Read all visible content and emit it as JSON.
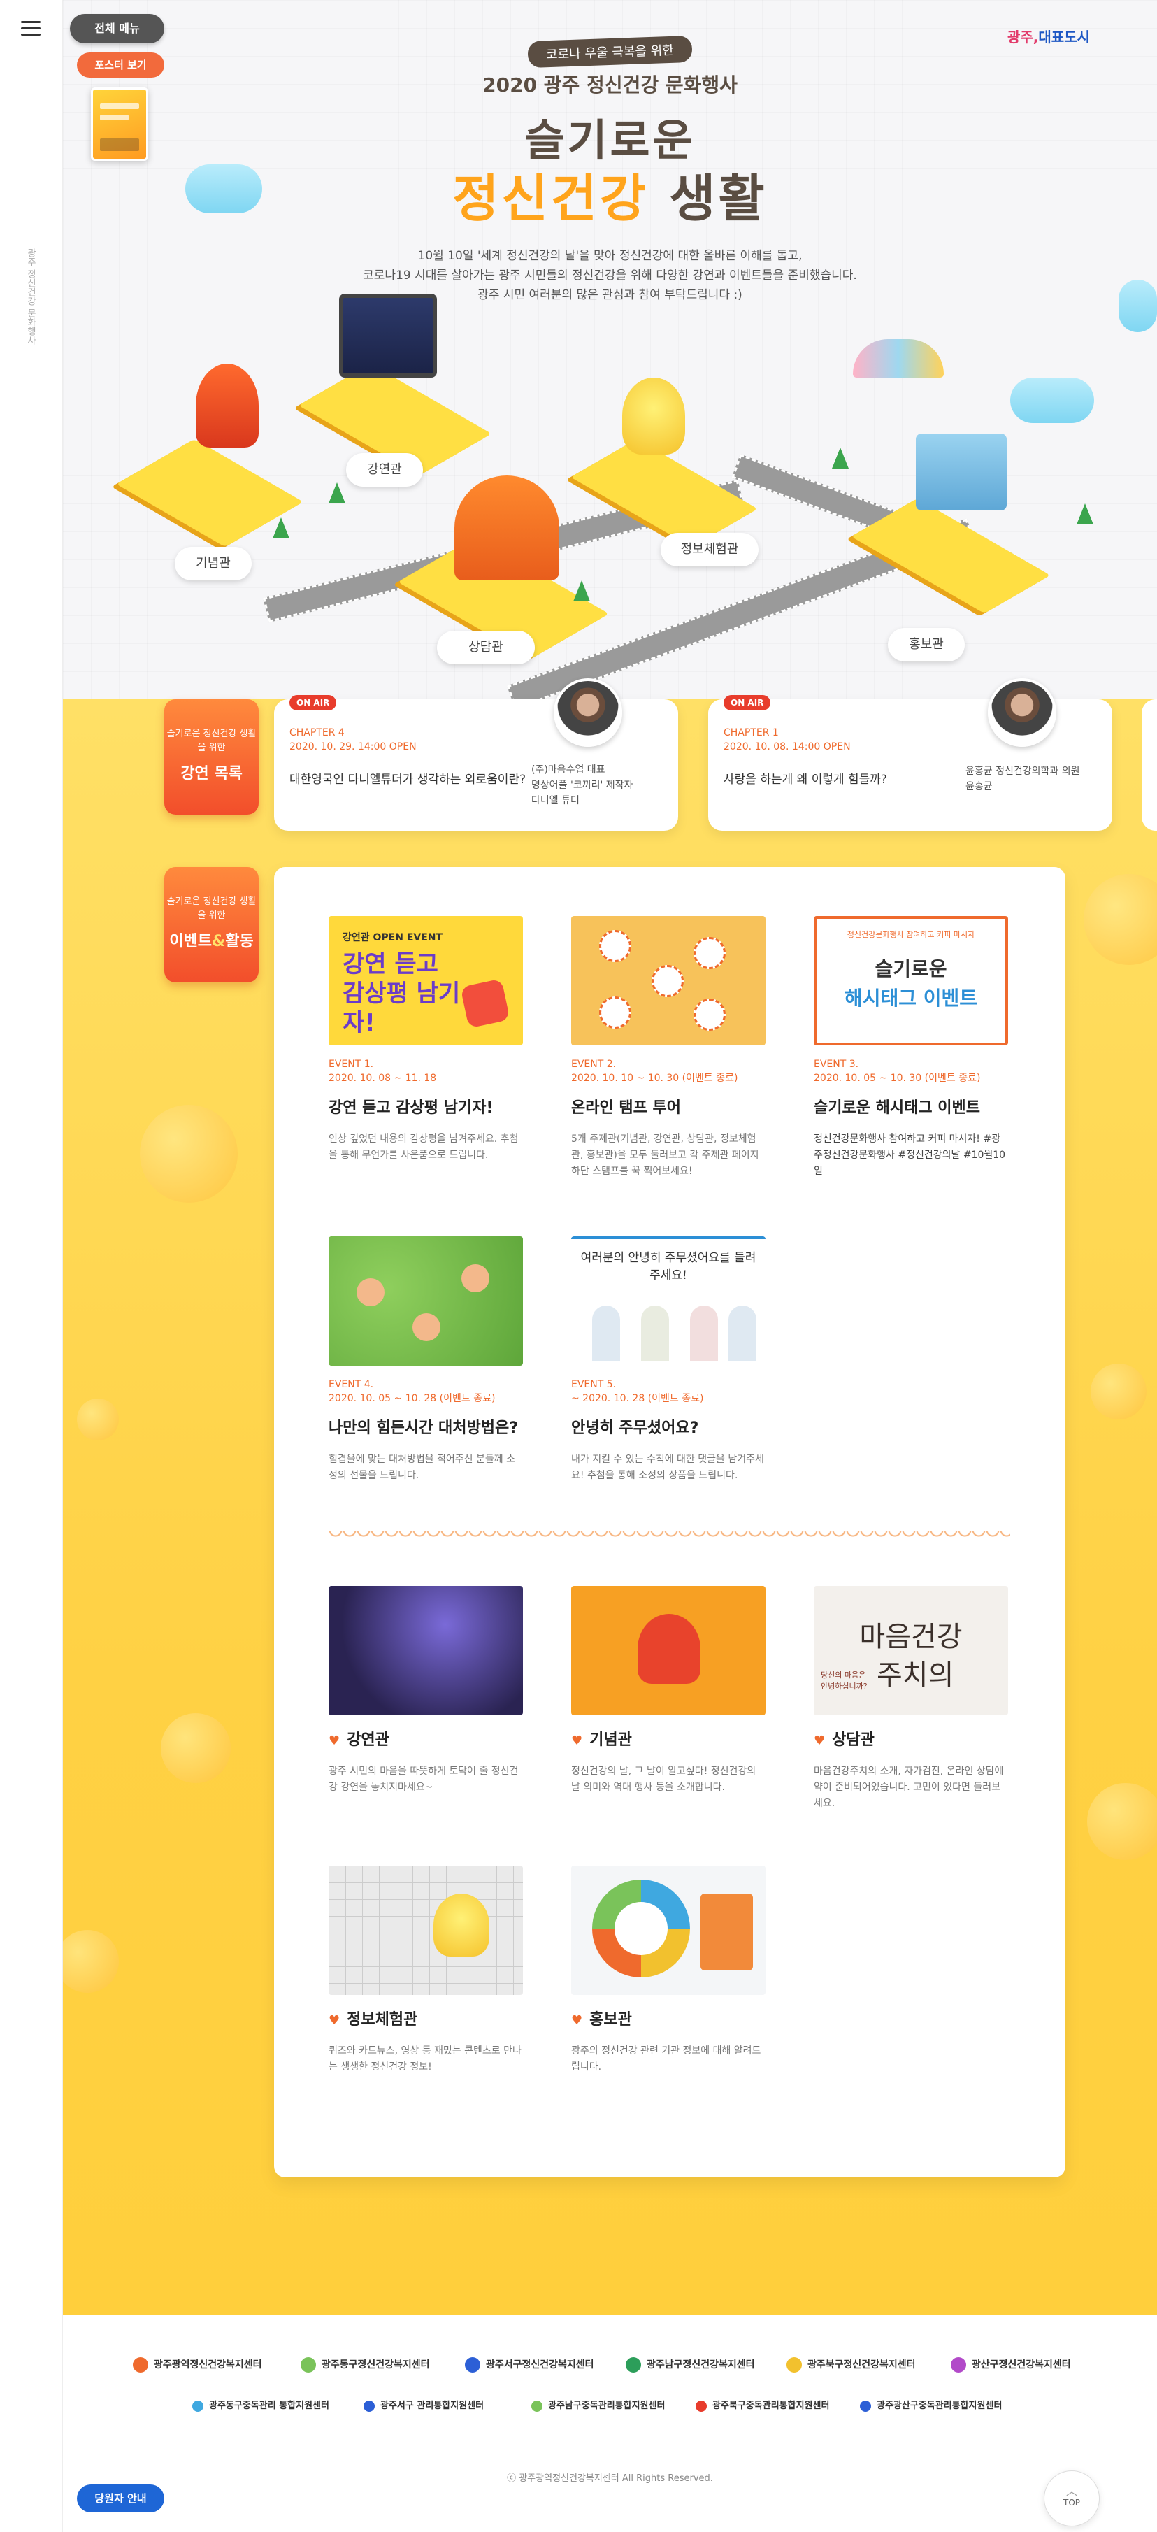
{
  "rail": {
    "menu_icon": "hamburger-icon",
    "vertical_text": "광주 정신건강 문화행사"
  },
  "buttons": {
    "all_menu": "전체 메뉴",
    "poster": "포스터 보기",
    "duty": "당원자 안내",
    "top": "TOP"
  },
  "hero": {
    "logo_text_a": "광주,",
    "logo_text_b": "대표도시",
    "pre_title": "코로나 우울 극복을 위한",
    "event_name": "2020 광주 정신건강 문화행사",
    "title_line1": "슬기로운",
    "title_line2_accent": "정신건강",
    "title_line2_rest": "생활",
    "intro_line1": "10월 10일 '세계 정신건강의 날'을 맞아 정신건강에 대한 올바른 이해를 돕고,",
    "intro_line2": "코로나19 시대를 살아가는 광주 시민들의 정신건강을 위해 다양한 강연과 이벤트들을 준비했습니다.",
    "intro_line3": "광주 시민 여러분의 많은 관심과 참여 부탁드립니다 :)",
    "halls": {
      "lecture": "강연관",
      "memorial": "기념관",
      "info": "정보체험관",
      "counsel": "상담관",
      "promo": "홍보관"
    }
  },
  "lecture_section": {
    "tag_small": "슬기로운 정신건강 생활을 위한",
    "tag_big": "강연 목록",
    "cards": [
      {
        "badge": "ON AIR",
        "chapter": "CHAPTER 4",
        "date": "2020. 10. 29. 14:00 OPEN",
        "title": "대한영국인 다니엘튜더가 생각하는 외로움이란?",
        "speaker_line1": "(주)마음수업 대표",
        "speaker_line2": "명상어플 '코끼리' 제작자",
        "speaker_line3": "다니엘 튜더"
      },
      {
        "badge": "ON AIR",
        "chapter": "CHAPTER 1",
        "date": "2020. 10. 08. 14:00 OPEN",
        "title": "사랑을 하는게 왜 이렇게 힘들까?",
        "speaker_line1": "윤홍균 정신건강의학과 의원",
        "speaker_line2": "윤홍균"
      }
    ]
  },
  "event_section": {
    "tag_small": "슬기로운 정신건강 생활을 위한",
    "tag_big_a": "이벤트",
    "tag_big_amp": "&",
    "tag_big_b": "활동",
    "events": [
      {
        "thumb_top": "강연관 OPEN EVENT",
        "thumb_big": "강연 듣고 감상평 남기자!",
        "num": "EVENT 1.",
        "date": "2020. 10. 08 ~ 11. 18",
        "title": "강연 듣고 감상평 남기자!",
        "desc": "인상 깊었던 내용의 감상평을 남겨주세요. 추첨을 통해 무언가를 사은품으로 드립니다."
      },
      {
        "num": "EVENT 2.",
        "date": "2020. 10. 10 ~ 10. 30 (이벤트 종료)",
        "title": "온라인 탬프 투어",
        "desc": "5개 주제관(기념관, 강연관, 상담관, 정보체험관, 홍보관)을 모두 둘러보고 각 주제관 페이지 하단 스탬프를 꾹 찍어보세요!"
      },
      {
        "thumb_top": "정신건강문화행사 참여하고 커피 마시자",
        "thumb_big_a": "슬기로운",
        "thumb_big_b": "해시태그 이벤트",
        "num": "EVENT 3.",
        "date": "2020. 10. 05 ~ 10. 30 (이벤트 종료)",
        "title": "슬기로운 해시태그 이벤트",
        "desc": "정신건강문화행사 참여하고 커피 마시자! #광주정신건강문화행사 #정신건강의날 #10월10일"
      },
      {
        "num": "EVENT 4.",
        "date": "2020. 10. 05 ~ 10. 28 (이벤트 종료)",
        "title": "나만의 힘든시간 대처방법은?",
        "desc": "힘겹을에 맞는 대처방법을 적어주신 분들께 소정의 선물을 드립니다."
      },
      {
        "thumb_top": "여러분의 안녕히 주무셨어요를 들려주세요!",
        "num": "EVENT 5.",
        "date": "~ 2020. 10. 28 (이벤트 종료)",
        "title": "안녕히 주무셨어요?",
        "desc": "내가 지킬 수 있는 수칙에 대한 댓글을 남겨주세요! 추첨을 통해 소정의 상품을 드립니다."
      }
    ],
    "halls": [
      {
        "title": "강연관",
        "desc": "광주 시민의 마음을 따뜻하게 토닥여 줄 정신건강 강연을 놓치지마세요~"
      },
      {
        "title": "기념관",
        "desc": "정신건강의 날, 그 날이 알고싶다! 정신건강의 날 의미와 역대 행사 등을 소개합니다."
      },
      {
        "title": "상담관",
        "thumb_text_a": "마음건강",
        "thumb_text_b": "주치의",
        "thumb_small": "당신의 마음은 안녕하십니까?",
        "desc": "마음건강주치의 소개, 자가검진, 온라인 상담예약이 준비되어있습니다. 고민이 있다면 들러보세요."
      },
      {
        "title": "정보체험관",
        "desc": "퀴즈와 카드뉴스, 영상 등 재밌는 콘텐츠로 만나는 생생한 정신건강 정보!"
      },
      {
        "title": "홍보관",
        "desc": "광주의 정신건강 관련 기관 정보에 대해 알려드립니다."
      }
    ]
  },
  "footer": {
    "orgs_row1": [
      "광주광역정신건강복지센터",
      "광주동구정신건강복지센터",
      "광주서구정신건강복지센터",
      "광주남구정신건강복지센터",
      "광주북구정신건강복지센터",
      "광산구정신건강복지센터"
    ],
    "orgs_row2": [
      "광주동구중독관리 통합지원센터",
      "광주서구 관리통합지원센터",
      "광주남구중독관리통합지원센터",
      "광주북구중독관리통합지원센터",
      "광주광산구중독관리통합지원센터"
    ],
    "copyright": "ⓒ 광주광역정신건강복지센터 All Rights Reserved."
  },
  "colors": {
    "accent": "#ef6a2d",
    "title_brown": "#5a4d42",
    "yellow": "#ffd144",
    "blue_button": "#1e66d6"
  }
}
